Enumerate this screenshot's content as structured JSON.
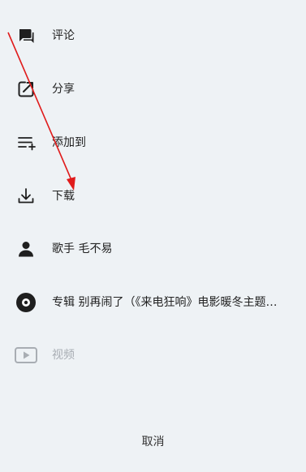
{
  "menu": {
    "items": [
      {
        "label": "评论",
        "icon": "comment-icon",
        "enabled": true
      },
      {
        "label": "分享",
        "icon": "share-icon",
        "enabled": true
      },
      {
        "label": "添加到",
        "icon": "add-to-playlist-icon",
        "enabled": true
      },
      {
        "label": "下载",
        "icon": "download-icon",
        "enabled": true
      },
      {
        "label": "歌手 毛不易",
        "icon": "singer-icon",
        "enabled": true
      },
      {
        "label": "专辑 别再闹了（《来电狂响》电影暖冬主题…",
        "icon": "album-icon",
        "enabled": true
      },
      {
        "label": "视频",
        "icon": "video-icon",
        "enabled": false
      }
    ],
    "cancel_label": "取消"
  },
  "colors": {
    "background": "#eef2f5",
    "text": "#222222",
    "disabled_text": "#a8adb3",
    "icon": "#1f1f1f",
    "annotation_arrow": "#e01b1b"
  }
}
